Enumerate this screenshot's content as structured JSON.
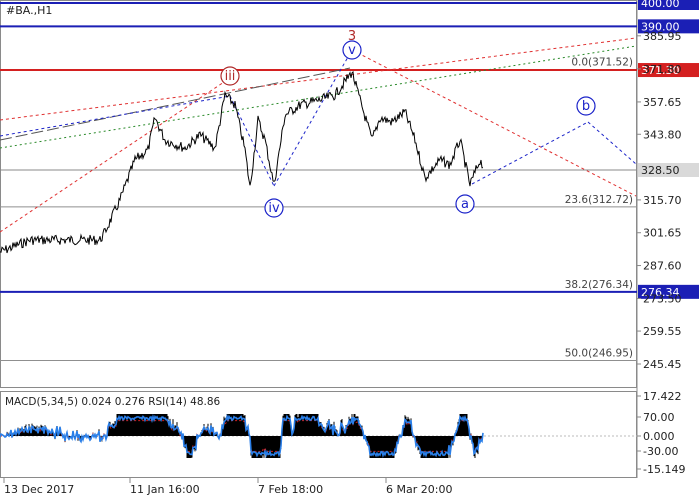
{
  "window": {
    "symbol_title": "#BA.,H1"
  },
  "price_scale": {
    "tick_labels": [
      "385.95",
      "371.80",
      "357.65",
      "343.80",
      "315.70",
      "301.65",
      "287.60",
      "273.50",
      "259.55",
      "245.45"
    ],
    "tick_values": [
      385.95,
      371.8,
      357.65,
      343.8,
      315.7,
      301.65,
      287.6,
      273.5,
      259.55,
      245.45
    ],
    "range": [
      233.0,
      404.0
    ]
  },
  "levels": [
    {
      "label": "400.00",
      "value": 400.0,
      "color": "#1b1fb5",
      "kind": "support-resistance"
    },
    {
      "label": "390.00",
      "value": 390.0,
      "color": "#1b1fb5",
      "kind": "support-resistance"
    },
    {
      "label": "371.30",
      "value": 371.3,
      "color": "#d42020",
      "kind": "support-resistance"
    },
    {
      "label": "328.50",
      "value": 328.5,
      "color": "#888888",
      "kind": "current-price"
    },
    {
      "label": "276.34",
      "value": 276.34,
      "color": "#1b1fb5",
      "kind": "support-resistance"
    }
  ],
  "fibonacci": [
    {
      "label": "0.0(371.52)",
      "value": 371.52
    },
    {
      "label": "23.6(312.72)",
      "value": 312.72
    },
    {
      "label": "38.2(276.34)",
      "value": 276.34
    },
    {
      "label": "50.0(246.95)",
      "value": 246.95
    }
  ],
  "wave_labels": [
    {
      "text": "3",
      "color": "#b02a2a",
      "circled": false
    },
    {
      "text": "v",
      "color": "#1b23c9",
      "circled": true
    },
    {
      "text": "iii",
      "color": "#b02a2a",
      "circled": true
    },
    {
      "text": "iv",
      "color": "#1b23c9",
      "circled": true
    },
    {
      "text": "a",
      "color": "#1b23c9",
      "circled": true
    },
    {
      "text": "b",
      "color": "#1b23c9",
      "circled": true
    }
  ],
  "indicator": {
    "title": "MACD(5,34,5) 0.024 0.276 RSI(14) 48.86",
    "scale_labels": [
      "17.422",
      "70.00",
      "0.000",
      "-30.00",
      "-15.149"
    ]
  },
  "time_axis": {
    "labels": [
      "13 Dec 2017",
      "11 Jan 16:00",
      "7 Feb 18:00",
      "6 Mar 20:00"
    ]
  },
  "colors": {
    "price_line": "#000000",
    "level_blue": "#1b1fb5",
    "level_red": "#d42020",
    "trend_red_dotted": "#e03030",
    "trend_green_dotted": "#2a8a2a",
    "rsi_line": "#2a7fe8",
    "macd_hist": "#000000",
    "macd_signal": "#d02020"
  }
}
